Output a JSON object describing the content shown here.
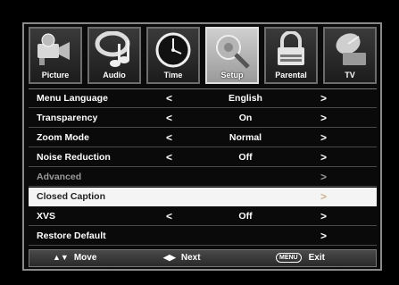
{
  "tabs": [
    {
      "label": "Picture",
      "icon": "camcorder-icon",
      "selected": false
    },
    {
      "label": "Audio",
      "icon": "music-note-icon",
      "selected": false
    },
    {
      "label": "Time",
      "icon": "clock-icon",
      "selected": false
    },
    {
      "label": "Setup",
      "icon": "wrench-gear-icon",
      "selected": true
    },
    {
      "label": "Parental",
      "icon": "padlock-icon",
      "selected": false
    },
    {
      "label": "TV",
      "icon": "satellite-dish-icon",
      "selected": false
    }
  ],
  "menu": {
    "rows": [
      {
        "label": "Menu Language",
        "left": "<",
        "value": "English",
        "right": ">"
      },
      {
        "label": "Transparency",
        "left": "<",
        "value": "On",
        "right": ">"
      },
      {
        "label": "Zoom Mode",
        "left": "<",
        "value": "Normal",
        "right": ">"
      },
      {
        "label": "Noise Reduction",
        "left": "<",
        "value": "Off",
        "right": ">"
      },
      {
        "label": "Advanced",
        "left": "",
        "value": "",
        "right": ">"
      },
      {
        "label": "Closed Caption",
        "left": "",
        "value": "",
        "right": ">"
      },
      {
        "label": "XVS",
        "left": "<",
        "value": "Off",
        "right": ">"
      },
      {
        "label": "Restore Default",
        "left": "",
        "value": "",
        "right": ">"
      }
    ],
    "highlighted_index": 5,
    "disabled_index": 4
  },
  "footer": {
    "move_glyph": "▲▼",
    "move_label": "Move",
    "next_glyph": "◀▶",
    "next_label": "Next",
    "menu_key": "MENU",
    "exit_label": "Exit"
  }
}
